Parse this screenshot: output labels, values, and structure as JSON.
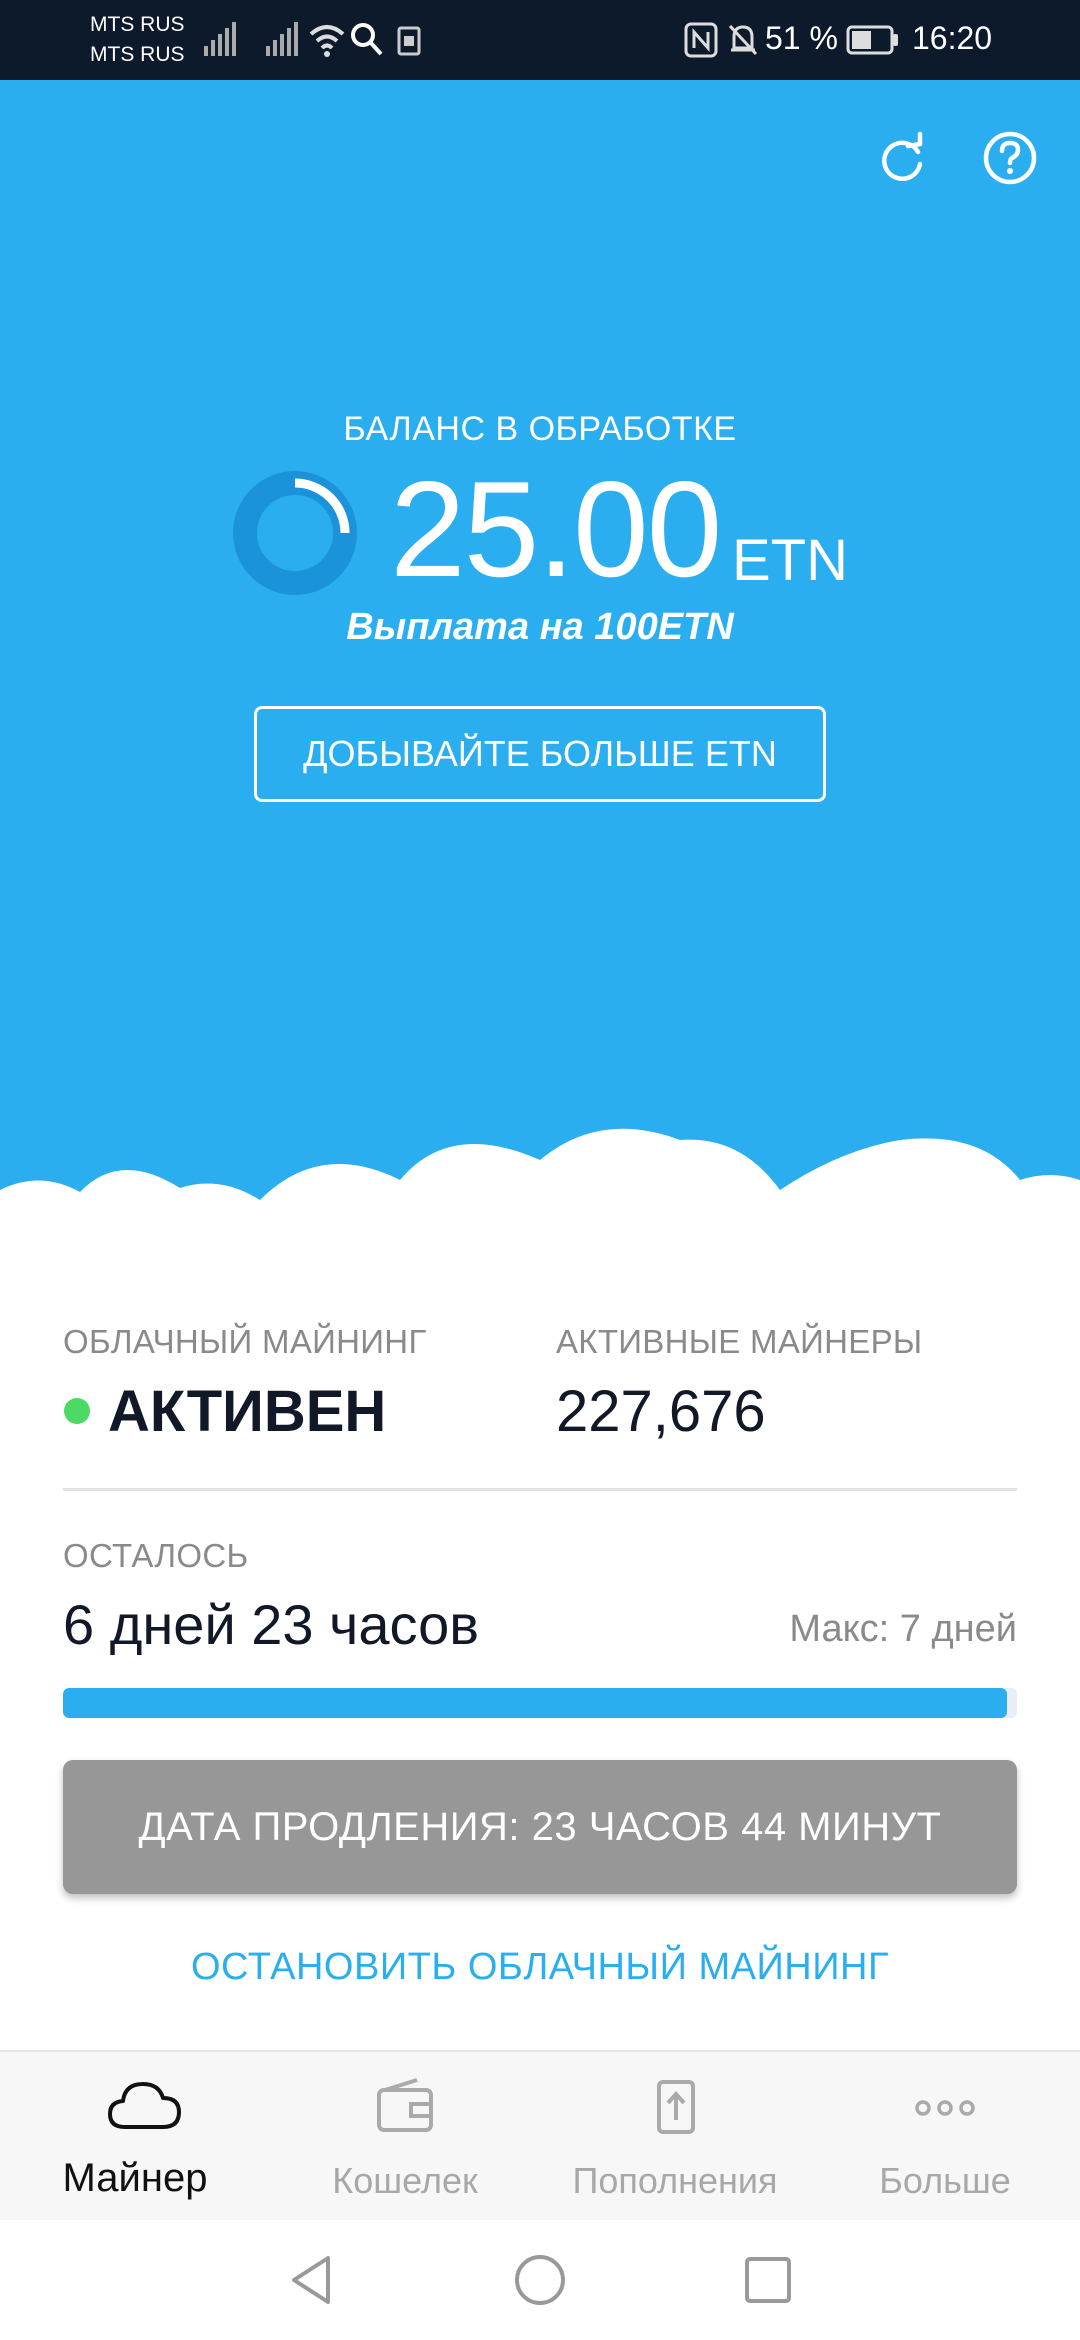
{
  "status_bar": {
    "carrier_1": "MTS RUS",
    "carrier_2": "MTS RUS",
    "battery": "51 %",
    "time": "16:20",
    "icons": [
      "signal-icon",
      "signal-icon",
      "wifi-icon",
      "search-icon",
      "sim-icon",
      "nfc-icon",
      "bell-off-icon",
      "battery-icon"
    ]
  },
  "header": {
    "icons": [
      "refresh-icon",
      "help-icon"
    ]
  },
  "balance": {
    "title": "БАЛАНС В ОБРАБОТКЕ",
    "amount": "25.00",
    "unit": "ETN",
    "payout_note": "Выплата на 100ETN",
    "progress_fraction": 0.25,
    "mine_more_label": "ДОБЫВАЙТЕ БОЛЬШЕ ETN"
  },
  "stats": {
    "cloud_mining_label": "ОБЛАЧНЫЙ МАЙНИНГ",
    "cloud_mining_status": "АКТИВЕН",
    "active_miners_label": "АКТИВНЫЕ МАЙНЕРЫ",
    "active_miners_value": "227,676"
  },
  "remaining": {
    "label": "ОСТАЛОСЬ",
    "value": "6 дней 23 часов",
    "max": "Макс: 7 дней",
    "progress_fraction": 0.99
  },
  "actions": {
    "renew_label": "ДАТА ПРОДЛЕНИЯ: 23 ЧАСОВ 44 МИНУТ",
    "stop_label": "ОСТАНОВИТЬ ОБЛАЧНЫЙ МАЙНИНГ"
  },
  "bottom_nav": {
    "items": [
      {
        "label": "Майнер",
        "icon": "cloud-icon",
        "active": true
      },
      {
        "label": "Кошелек",
        "icon": "wallet-icon",
        "active": false
      },
      {
        "label": "Пополнения",
        "icon": "upload-icon",
        "active": false
      },
      {
        "label": "Больше",
        "icon": "more-icon",
        "active": false
      }
    ]
  },
  "colors": {
    "accent": "#2aaef0",
    "status_bar": "#0c1a2b",
    "active_dot": "#4cd964",
    "renew_button": "#979797"
  }
}
